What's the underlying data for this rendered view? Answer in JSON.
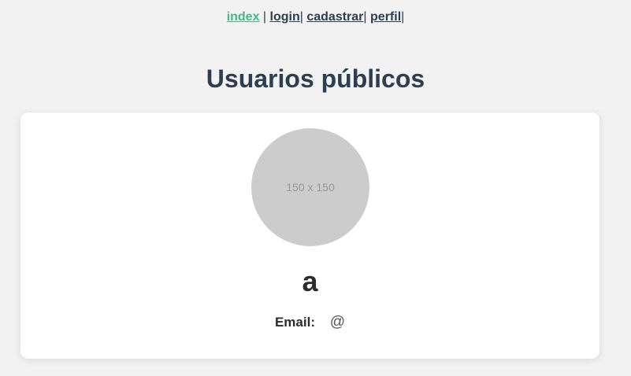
{
  "nav": {
    "items": [
      {
        "label": "index"
      },
      {
        "label": "login"
      },
      {
        "label": "cadastrar"
      },
      {
        "label": "perfil"
      }
    ],
    "sep_first": " | ",
    "sep": "| ",
    "sep_last": "|"
  },
  "page": {
    "title": "Usuarios públicos"
  },
  "user": {
    "avatar_text": "150 x 150",
    "name": "a",
    "email_label": "Email:",
    "email_value": "@"
  },
  "colors": {
    "active_link": "#42b983",
    "text": "#2c3e50",
    "avatar_bg": "#cccccc"
  }
}
